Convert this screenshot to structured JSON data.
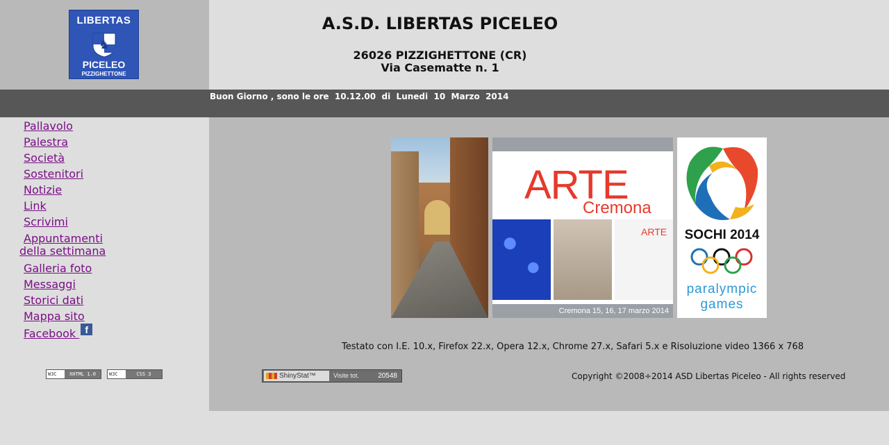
{
  "logo": {
    "line1": "LIBERTAS",
    "line2": "PICELEO",
    "line3": "PIZZIGHETTONE"
  },
  "header": {
    "title": "A.S.D. LIBERTAS PICELEO",
    "address_line1": "26026 PIZZIGHETTONE (CR)",
    "address_line2": "Via Casematte n. 1"
  },
  "greeting": "Buon Giorno , sono le ore  10.12.00  di  Lunedi  10  Marzo  2014",
  "nav": {
    "items": [
      {
        "label": "Pallavolo"
      },
      {
        "label": "Palestra"
      },
      {
        "label": "Società"
      },
      {
        "label": "Sostenitori"
      },
      {
        "label": "Notizie"
      },
      {
        "label": "Link"
      },
      {
        "label": "Scrivimi"
      },
      {
        "label": "Appuntamenti"
      },
      {
        "label": "della settimana"
      },
      {
        "label": "Galleria foto"
      },
      {
        "label": "Messaggi"
      },
      {
        "label": "Storici dati"
      },
      {
        "label": "Mappa sito"
      },
      {
        "label": "Facebook "
      }
    ],
    "facebook_icon": "f"
  },
  "badges": {
    "xhtml": {
      "left": "W3C",
      "right": "XHTML 1.0"
    },
    "css": {
      "left": "W3C",
      "right": "CSS 3"
    }
  },
  "banners": {
    "arte": {
      "title": "ARTE",
      "subtitle": "Cremona",
      "mini": "ARTE",
      "footer": "Cremona 15, 16, 17 marzo 2014"
    },
    "sochi": {
      "title": "SOCHI 2014",
      "subtitle1": "paralympic",
      "subtitle2": "games"
    }
  },
  "footer": {
    "tested": "Testato con I.E. 10.x, Firefox 22.x, Opera 12.x, Chrome 27.x, Safari 5.x e Risoluzione video 1366 x 768",
    "counter": {
      "brand": "ShinyStat™",
      "label": "Visite tot.",
      "value": "20548"
    },
    "copyright": "Copyright ©2008÷2014 ASD Libertas Piceleo - All rights reserved"
  },
  "colors": {
    "link": "#7a0f86",
    "bar": "#575757",
    "panel": "#b9b9b9",
    "background": "#dedede"
  }
}
